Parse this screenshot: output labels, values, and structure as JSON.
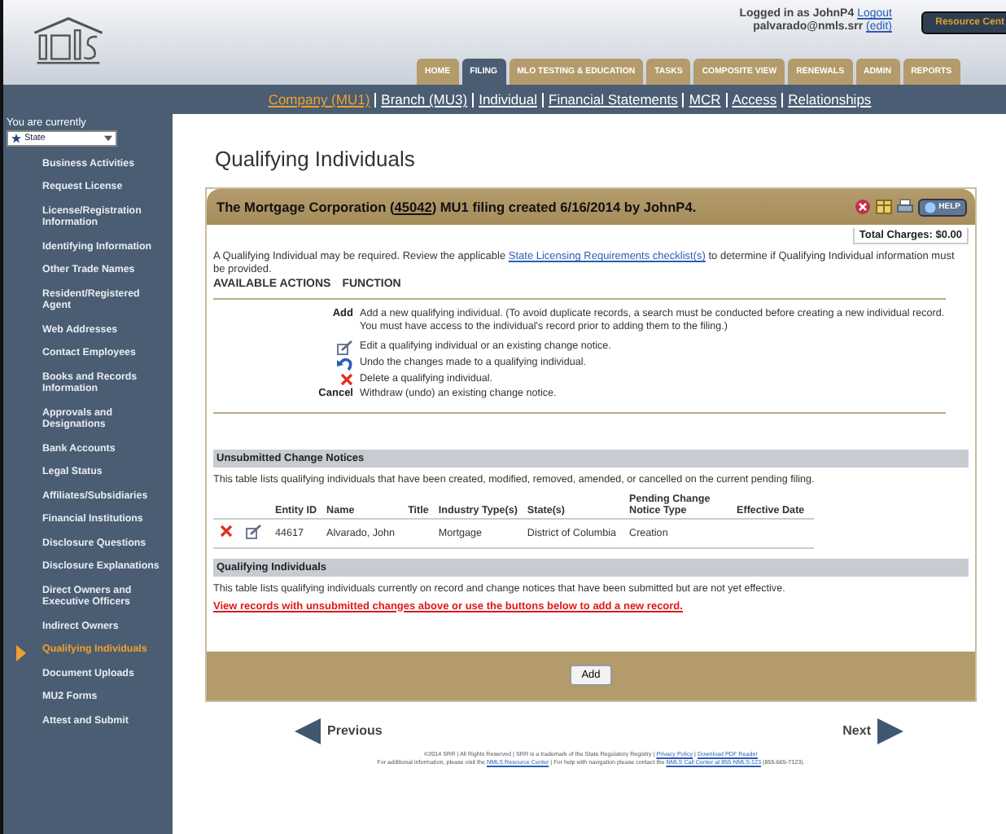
{
  "header": {
    "login_text": "Logged in as JohnP4",
    "logout": "Logout",
    "email": "palvarado@nmls.srr",
    "edit_link": "(edit)",
    "resource_button": "Resource Cent"
  },
  "tabs": [
    {
      "label": "HOME",
      "selected": false
    },
    {
      "label": "FILING",
      "selected": true
    },
    {
      "label": "MLO TESTING & EDUCATION",
      "selected": false
    },
    {
      "label": "TASKS",
      "selected": false
    },
    {
      "label": "COMPOSITE VIEW",
      "selected": false
    },
    {
      "label": "RENEWALS",
      "selected": false
    },
    {
      "label": "ADMIN",
      "selected": false
    },
    {
      "label": "REPORTS",
      "selected": false
    }
  ],
  "subnav": [
    {
      "label": "Company (MU1)",
      "selected": true
    },
    {
      "label": "Branch (MU3)",
      "selected": false
    },
    {
      "label": "Individual",
      "selected": false
    },
    {
      "label": "Financial Statements",
      "selected": false
    },
    {
      "label": "MCR",
      "selected": false
    },
    {
      "label": "Access",
      "selected": false
    },
    {
      "label": "Relationships",
      "selected": false
    }
  ],
  "sidebar": {
    "caption": "You are currently",
    "dropdown": "State",
    "items": [
      {
        "label": "Business Activities",
        "selected": false
      },
      {
        "label": "Request License",
        "selected": false
      },
      {
        "label": "License/Registration Information",
        "selected": false
      },
      {
        "label": "Identifying Information",
        "selected": false
      },
      {
        "label": "Other Trade Names",
        "selected": false
      },
      {
        "label": "Resident/Registered Agent",
        "selected": false
      },
      {
        "label": "Web Addresses",
        "selected": false
      },
      {
        "label": "Contact Employees",
        "selected": false
      },
      {
        "label": "Books and Records Information",
        "selected": false
      },
      {
        "label": "Approvals and Designations",
        "selected": false
      },
      {
        "label": "Bank Accounts",
        "selected": false
      },
      {
        "label": "Legal Status",
        "selected": false
      },
      {
        "label": "Affiliates/Subsidiaries",
        "selected": false
      },
      {
        "label": "Financial Institutions",
        "selected": false
      },
      {
        "label": "Disclosure Questions",
        "selected": false
      },
      {
        "label": "Disclosure Explanations",
        "selected": false
      },
      {
        "label": "Direct Owners and Executive Officers",
        "selected": false
      },
      {
        "label": "Indirect Owners",
        "selected": false
      },
      {
        "label": "Qualifying Individuals",
        "selected": true
      },
      {
        "label": "Document Uploads",
        "selected": false
      },
      {
        "label": "MU2 Forms",
        "selected": false
      },
      {
        "label": "Attest and Submit",
        "selected": false
      }
    ]
  },
  "page_title": "Qualifying Individuals",
  "panel": {
    "title_before": "The Mortgage Corporation (",
    "title_link": "45042",
    "title_after": ") MU1 filing created 6/16/2014 by JohnP4.",
    "help": "HELP",
    "total_charges": "Total Charges: $0.00",
    "intro_before": "A Qualifying Individual may be required. Review the applicable ",
    "intro_link": "State Licensing Requirements checklist(s)",
    "intro_after": " to determine if Qualifying Individual information must be provided.",
    "actions_heading": "AVAILABLE ACTIONS",
    "function_heading": "FUNCTION",
    "actions": [
      {
        "kind": "label",
        "label": "Add",
        "text": "Add a new qualifying individual. (To avoid duplicate records, a search must be conducted before creating a new individual record. You must have access to the individual's record prior to adding them to the filing.)"
      },
      {
        "kind": "edit",
        "text": "Edit a qualifying individual or an existing change notice."
      },
      {
        "kind": "undo",
        "text": "Undo the changes made to a qualifying individual."
      },
      {
        "kind": "delete",
        "text": "Delete a qualifying individual."
      },
      {
        "kind": "label",
        "label": "Cancel",
        "text": "Withdraw (undo) an existing change notice."
      }
    ],
    "unsubmitted": {
      "title": "Unsubmitted Change Notices",
      "description": "This table lists qualifying individuals that have been created, modified, removed, amended, or cancelled on the current pending filing.",
      "columns": [
        "Entity ID",
        "Name",
        "Title",
        "Industry Type(s)",
        "State(s)",
        "Pending Change Notice Type",
        "Effective Date"
      ],
      "rows": [
        {
          "cells": [
            "44617",
            "Alvarado, John",
            "",
            "Mortgage",
            "District of Columbia",
            "Creation",
            ""
          ]
        }
      ]
    },
    "qualifying": {
      "title": "Qualifying Individuals",
      "description": "This table lists qualifying individuals currently on record and change notices that have been submitted but are not yet effective.",
      "notice": "View records with unsubmitted changes above or use the buttons below to add a new record."
    },
    "add_button": "Add"
  },
  "nav": {
    "previous": "Previous",
    "next": "Next"
  },
  "footer": {
    "line1_before": "©2014 SRR | All Rights Reserved | SRR is a trademark of the State Regulatory Registry | ",
    "privacy": "Privacy Policy",
    "sep": " | ",
    "pdf": "Download PDF Reader",
    "line2_before": "For additional information, please visit the ",
    "resource": "NMLS Resource Center",
    "line2_middle": " | For help with navigation please contact the ",
    "call": "NMLS Call Center at 855-NMLS-123",
    "line2_after": " (855-665-7123)."
  }
}
